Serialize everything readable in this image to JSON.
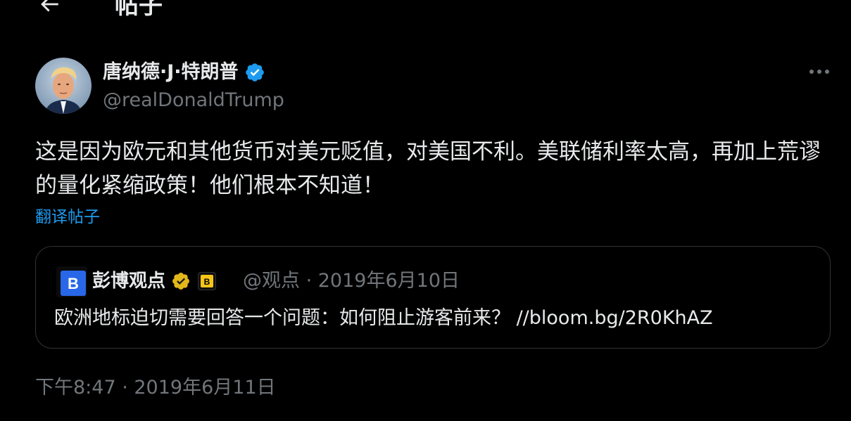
{
  "header": {
    "title": "帖子"
  },
  "author": {
    "display_name": "唐纳德·J·特朗普",
    "handle": "@realDonaldTrump"
  },
  "tweet": {
    "text": "这是因为欧元和其他货币对美元贬值，对美国不利。美联储利率太高，再加上荒谬的量化紧缩政策！他们根本不知道！",
    "translate_label": "翻译帖子",
    "timestamp": "下午8:47 · 2019年6月11日"
  },
  "quote": {
    "avatar_letter": "B",
    "badge_letter": "B",
    "name": "彭博观点",
    "meta": "@观点 · 2019年6月10日",
    "text": "欧洲地标迫切需要回答一个问题：如何阻止游客前来？ //bloom.bg/2R0KhAZ"
  },
  "colors": {
    "background": "#000000",
    "text_primary": "#e7e9ea",
    "text_secondary": "#71767b",
    "link": "#1d9bf0",
    "border": "#2f3336",
    "verified_blue": "#1d9bf0",
    "verified_gold": "#e2b719"
  },
  "icons": {
    "back": "arrow-left-icon",
    "verified": "verified-badge-icon",
    "gold_verified": "gold-verified-badge-icon",
    "more": "more-horizontal-icon"
  }
}
